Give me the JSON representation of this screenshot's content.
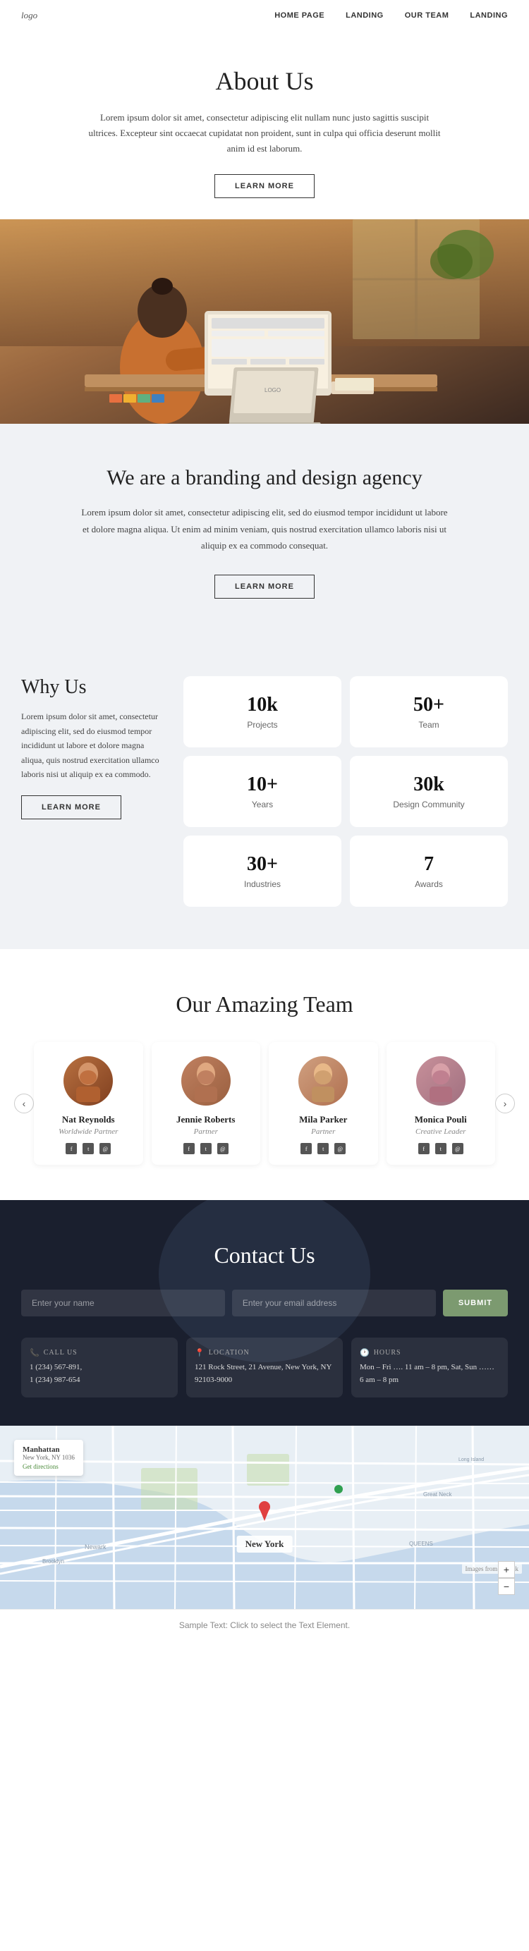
{
  "nav": {
    "logo": "logo",
    "links": [
      "HOME PAGE",
      "LANDING",
      "OUR TEAM",
      "LANDING"
    ]
  },
  "about": {
    "title": "About Us",
    "description": "Lorem ipsum dolor sit amet, consectetur adipiscing elit nullam nunc justo sagittis suscipit ultrices. Excepteur sint occaecat cupidatat non proident, sunt in culpa qui officia deserunt mollit anim id est laborum.",
    "btn_label": "LEARN MORE"
  },
  "branding": {
    "title": "We are a branding and design agency",
    "description": "Lorem ipsum dolor sit amet, consectetur adipiscing elit, sed do eiusmod tempor incididunt ut labore et dolore magna aliqua. Ut enim ad minim veniam, quis nostrud exercitation ullamco laboris nisi ut aliquip ex ea commodo consequat.",
    "btn_label": "LEARN MORE"
  },
  "why_us": {
    "title": "Why Us",
    "description": "Lorem ipsum dolor sit amet, consectetur adipiscing elit, sed do eiusmod tempor incididunt ut labore et dolore magna aliqua, quis nostrud exercitation ullamco laboris nisi ut aliquip ex ea commodo.",
    "btn_label": "LEARN MORE",
    "stats": [
      {
        "num": "10k",
        "label": "Projects"
      },
      {
        "num": "50+",
        "label": "Team"
      },
      {
        "num": "10+",
        "label": "Years"
      },
      {
        "num": "30k",
        "label": "Design Community"
      },
      {
        "num": "30+",
        "label": "Industries"
      },
      {
        "num": "7",
        "label": "Awards"
      }
    ]
  },
  "team": {
    "title": "Our Amazing Team",
    "members": [
      {
        "name": "Nat Reynolds",
        "role": "Worldwide Partner"
      },
      {
        "name": "Jennie Roberts",
        "role": "Partner"
      },
      {
        "name": "Mila Parker",
        "role": "Partner"
      },
      {
        "name": "Monica Pouli",
        "role": "Creative Leader"
      }
    ]
  },
  "contact": {
    "title": "Contact Us",
    "form": {
      "name_placeholder": "Enter your name",
      "email_placeholder": "Enter your email address",
      "submit_label": "SUBMIT"
    },
    "cards": [
      {
        "icon": "📞",
        "title": "CALL US",
        "lines": [
          "1 (234) 567-891,",
          "1 (234) 987-654"
        ]
      },
      {
        "icon": "📍",
        "title": "LOCATION",
        "lines": [
          "121 Rock Street, 21 Avenue, New York, NY",
          "92103-9000"
        ]
      },
      {
        "icon": "🕐",
        "title": "HOURS",
        "lines": [
          "Mon – Fri …. 11 am – 8 pm, Sat, Sun ……",
          "6 am – 8 pm"
        ]
      }
    ]
  },
  "map": {
    "label": "New York",
    "info_title": "Manhattan",
    "info_sub": "New York, NY 1036",
    "freepik": "Images from Freepik",
    "zoom_plus": "+",
    "zoom_minus": "−"
  },
  "footer": {
    "sample_text": "Sample Text: Click to select the Text Element."
  }
}
